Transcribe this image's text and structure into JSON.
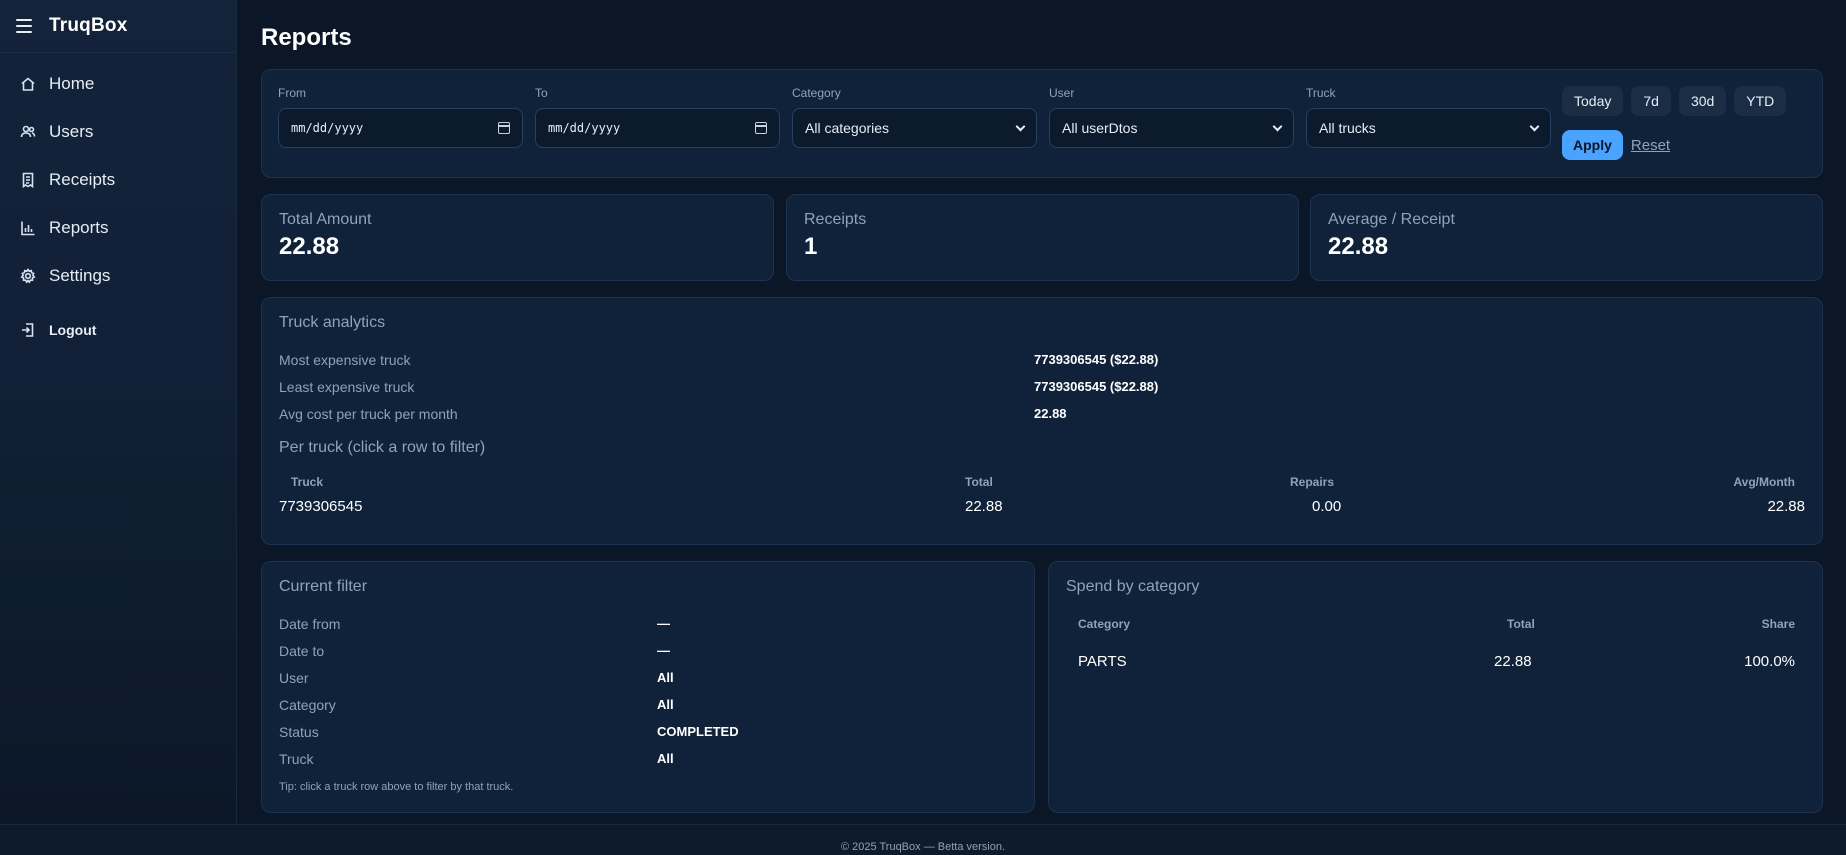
{
  "app": {
    "title": "TruqBox"
  },
  "nav": {
    "items": [
      {
        "label": "Home",
        "icon": "home-icon"
      },
      {
        "label": "Users",
        "icon": "users-icon"
      },
      {
        "label": "Receipts",
        "icon": "receipt-icon"
      },
      {
        "label": "Reports",
        "icon": "bar-chart-icon"
      },
      {
        "label": "Settings",
        "icon": "gear-icon"
      }
    ],
    "logout": "Logout"
  },
  "page": {
    "title": "Reports"
  },
  "filters": {
    "from": {
      "label": "From",
      "placeholder": "mm/dd/yyyy"
    },
    "to": {
      "label": "To",
      "placeholder": "mm/dd/yyyy"
    },
    "category": {
      "label": "Category",
      "value": "All categories"
    },
    "user": {
      "label": "User",
      "value": "All userDtos"
    },
    "truck": {
      "label": "Truck",
      "value": "All trucks"
    },
    "quick": [
      "Today",
      "7d",
      "30d",
      "YTD"
    ],
    "apply": "Apply",
    "reset": "Reset"
  },
  "stats": [
    {
      "label": "Total Amount",
      "value": "22.88"
    },
    {
      "label": "Receipts",
      "value": "1"
    },
    {
      "label": "Average / Receipt",
      "value": "22.88"
    }
  ],
  "truck_analytics": {
    "title": "Truck analytics",
    "rows": [
      {
        "key": "Most expensive truck",
        "value": "7739306545 ($22.88)"
      },
      {
        "key": "Least expensive truck",
        "value": "7739306545 ($22.88)"
      },
      {
        "key": "Avg cost per truck per month",
        "value": "22.88"
      }
    ],
    "per_truck_title": "Per truck (click a row to filter)",
    "columns": [
      "Truck",
      "Total",
      "Repairs",
      "Avg/Month"
    ],
    "table": [
      {
        "truck": "7739306545",
        "total": "22.88",
        "repairs": "0.00",
        "avg": "22.88"
      }
    ]
  },
  "current_filter": {
    "title": "Current filter",
    "rows": [
      {
        "key": "Date from",
        "value": "—"
      },
      {
        "key": "Date to",
        "value": "—"
      },
      {
        "key": "User",
        "value": "All"
      },
      {
        "key": "Category",
        "value": "All"
      },
      {
        "key": "Status",
        "value": "COMPLETED"
      },
      {
        "key": "Truck",
        "value": "All"
      }
    ],
    "tip": "Tip: click a truck row above to filter by that truck."
  },
  "spend": {
    "title": "Spend by category",
    "columns": [
      "Category",
      "Total",
      "Share"
    ],
    "rows": [
      {
        "category": "PARTS",
        "total": "22.88",
        "share": "100.0%"
      }
    ]
  },
  "footer": {
    "text": "© 2025 TruqBox — Betta version."
  },
  "colors": {
    "background": "#0b1727",
    "card": "#10223a",
    "accent": "#4aa3ff",
    "muted": "#8fa2bb"
  }
}
